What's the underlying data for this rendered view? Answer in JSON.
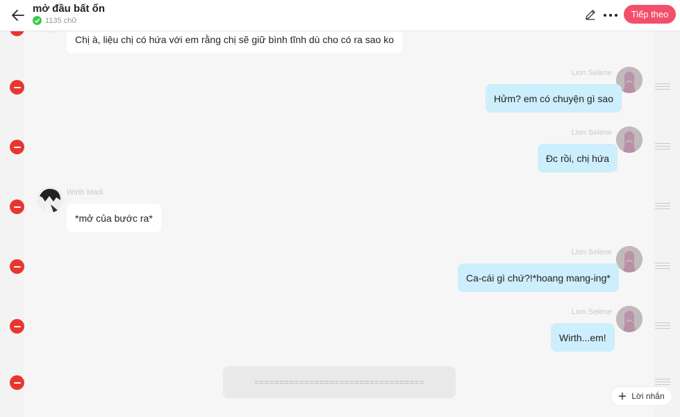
{
  "header": {
    "title": "mở đầu bất ổn",
    "word_count": "1135 chữ",
    "next_label": "Tiếp theo"
  },
  "messages": [
    {
      "side": "left",
      "text": "Chị à, liệu chị có hứa với em rằng chị sẽ giữ bình tĩnh dù cho có ra sao ko"
    },
    {
      "side": "right",
      "name": "Lion Selene",
      "text": "Hửm? em có chuyện gì sao"
    },
    {
      "side": "right",
      "name": "Lion Selene",
      "text": "Đc rồi, chị hứa"
    },
    {
      "side": "left",
      "name": "Wirth Madi",
      "text": "*mở của bước ra*"
    },
    {
      "side": "right",
      "name": "Lion Selene",
      "text": "Ca-cái gì chứ?!*hoang mang-ing*"
    },
    {
      "side": "right",
      "name": "Lion Selene",
      "text": "Wirth...em!"
    }
  ],
  "separator": "==================================",
  "add_message_label": "Lời nhắn",
  "colors": {
    "accent": "#f24f6b",
    "delete": "#e8362f",
    "right_bubble": "#cdeefc",
    "left_bubble": "#ffffff",
    "check": "#3ec84a"
  }
}
